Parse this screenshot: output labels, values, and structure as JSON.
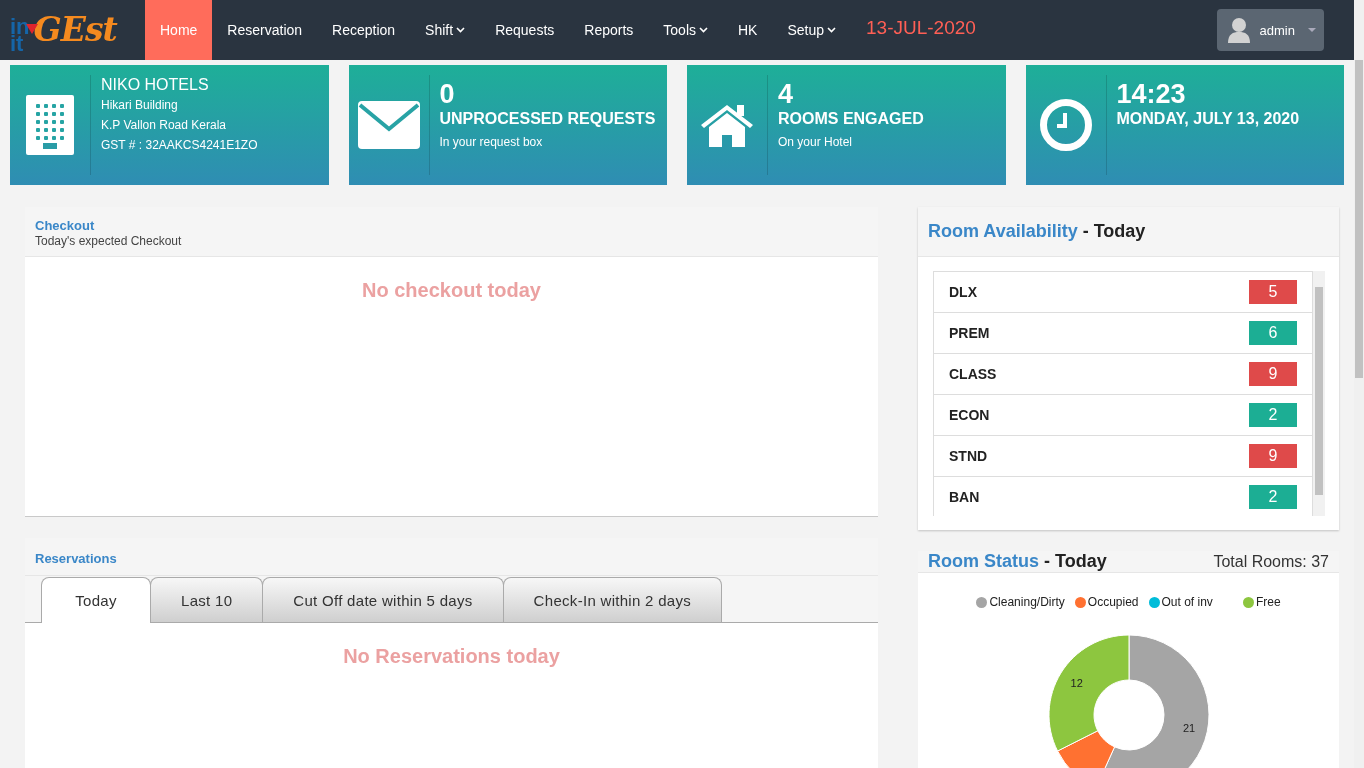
{
  "nav": {
    "logo": {
      "part_1": "in",
      "part_2": "it",
      "part_3": "GEst"
    },
    "menu": [
      {
        "label": "Home",
        "selected": true,
        "dropdown": false
      },
      {
        "label": "Reservation",
        "selected": false,
        "dropdown": false
      },
      {
        "label": "Reception",
        "selected": false,
        "dropdown": false
      },
      {
        "label": "Shift",
        "selected": false,
        "dropdown": true
      },
      {
        "label": "Requests",
        "selected": false,
        "dropdown": false
      },
      {
        "label": "Reports",
        "selected": false,
        "dropdown": false
      },
      {
        "label": "Tools",
        "selected": false,
        "dropdown": true
      },
      {
        "label": "HK",
        "selected": false,
        "dropdown": false
      },
      {
        "label": "Setup",
        "selected": false,
        "dropdown": true
      }
    ],
    "date": "13-JUL-2020",
    "user": "admin"
  },
  "stat_cards": [
    {
      "kind": "hotel",
      "title": "NIKO HOTELS",
      "lines": [
        "Hikari Building",
        "K.P Vallon Road Kerala",
        "GST # : 32AAKCS4241E1ZO"
      ]
    },
    {
      "kind": "requests",
      "value": "0",
      "title": "UNPROCESSED REQUESTS",
      "subtitle": "In your request box"
    },
    {
      "kind": "rooms",
      "value": "4",
      "title": "ROOMS ENGAGED",
      "subtitle": "On your Hotel"
    },
    {
      "kind": "clock",
      "value": "14:23",
      "title": "MONDAY, JULY 13, 2020"
    }
  ],
  "checkout": {
    "title": "Checkout",
    "subtitle": "Today's expected Checkout",
    "message": "No checkout today"
  },
  "reservations": {
    "title": "Reservations",
    "tabs": [
      {
        "label": "Today",
        "selected": true
      },
      {
        "label": "Last 10",
        "selected": false
      },
      {
        "label": "Cut Off date within 5 days",
        "selected": false
      },
      {
        "label": "Check-In within 2 days",
        "selected": false
      }
    ],
    "message": "No Reservations today"
  },
  "availability": {
    "title": "Room Availability",
    "suffix": "- Today",
    "rooms": [
      {
        "name": "DLX",
        "count": "5",
        "color": "#df4a4a"
      },
      {
        "name": "PREM",
        "count": "6",
        "color": "#1cae94"
      },
      {
        "name": "CLASS",
        "count": "9",
        "color": "#df4a4a"
      },
      {
        "name": "ECON",
        "count": "2",
        "color": "#1cae94"
      },
      {
        "name": "STND",
        "count": "9",
        "color": "#df4a4a"
      },
      {
        "name": "BAN",
        "count": "2",
        "color": "#1cae94"
      }
    ]
  },
  "room_status": {
    "title": "Room Status",
    "suffix": "- Today",
    "total": "Total Rooms: 37",
    "chart_data": {
      "type": "donut",
      "categories": [
        "Cleaning/Dirty",
        "Occupied",
        "Out of inv",
        "Free"
      ],
      "values": [
        21,
        4,
        0,
        12
      ],
      "colors": [
        "#a5a5a5",
        "#ff7131",
        "#00bcd9",
        "#8dc63f"
      ],
      "value_labels": [
        "21",
        null,
        null,
        "12"
      ]
    }
  }
}
